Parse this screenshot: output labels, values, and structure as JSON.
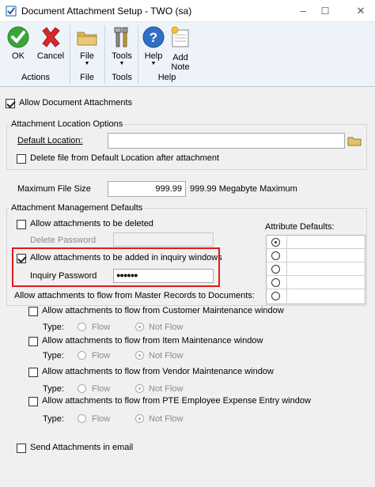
{
  "window": {
    "title": "Document Attachment Setup - TWO (sa)",
    "minimize": "–",
    "maximize": "☐",
    "close": "✕"
  },
  "ribbon": {
    "ok": "OK",
    "cancel": "Cancel",
    "actions_group": "Actions",
    "file": "File",
    "file_group": "File",
    "tools": "Tools",
    "tools_group": "Tools",
    "help": "Help",
    "add_note_line1": "Add",
    "add_note_line2": "Note",
    "help_group": "Help",
    "dropdown_arrow": "▼"
  },
  "allow_document_attachments": {
    "label": "Allow Document Attachments",
    "checked": true
  },
  "attachment_location": {
    "group_label": "Attachment Location Options",
    "default_location_label": "Default Location:",
    "default_location_value": "",
    "delete_file_label": "Delete file from Default Location after attachment"
  },
  "max_file_size": {
    "label": "Maximum File Size",
    "value": "999.99",
    "note": "999.99 Megabyte Maximum"
  },
  "management_defaults": {
    "group_label": "Attachment Management Defaults",
    "allow_deleted_label": "Allow attachments to be deleted",
    "delete_password_label": "Delete Password",
    "delete_password_value": "",
    "allow_inquiry_label": "Allow attachments to be added in inquiry windows",
    "inquiry_password_label": "Inquiry Password",
    "inquiry_password_value": "●●●●●●",
    "attribute_defaults_label": "Attribute Defaults:"
  },
  "flow": {
    "heading": "Allow attachments to flow from Master Records to Documents:",
    "type_label": "Type:",
    "flow_option": "Flow",
    "not_flow_option": "Not Flow",
    "items": [
      {
        "label": "Allow attachments to flow from Customer Maintenance window"
      },
      {
        "label": "Allow attachments to flow from Item Maintenance window"
      },
      {
        "label": "Allow attachments to flow from Vendor Maintenance window"
      },
      {
        "label": "Allow attachments to flow from PTE Employee Expense Entry window"
      }
    ]
  },
  "send_in_email": {
    "label": "Send Attachments in email"
  },
  "colors": {
    "highlight": "#e01a1a",
    "ribbon_bg": "#eef3fa"
  }
}
